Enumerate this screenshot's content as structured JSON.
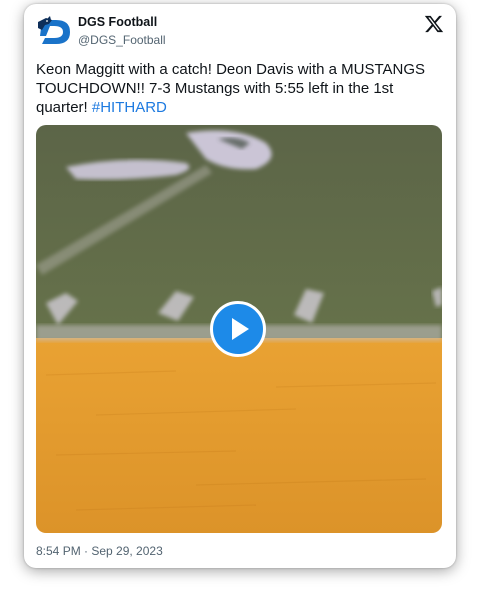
{
  "account": {
    "name": "DGS Football",
    "handle": "@DGS_Football",
    "logo_icon": "mustang-d-logo-icon"
  },
  "platform_icon": "x-logo-icon",
  "tweet": {
    "text": "Keon Maggitt with a catch! Deon Davis with a MUSTANGS TOUCHDOWN!! 7-3 Mustangs with 5:55 left in the 1st quarter! ",
    "hashtag": "#HITHARD"
  },
  "media": {
    "type": "video",
    "play_icon": "play-icon"
  },
  "timestamp": "8:54 PM · Sep 29, 2023",
  "colors": {
    "accent": "#1d8ae8",
    "hashtag": "#1d7ae0",
    "turf": "#5f6b45",
    "endzone": "#e39a2e"
  }
}
